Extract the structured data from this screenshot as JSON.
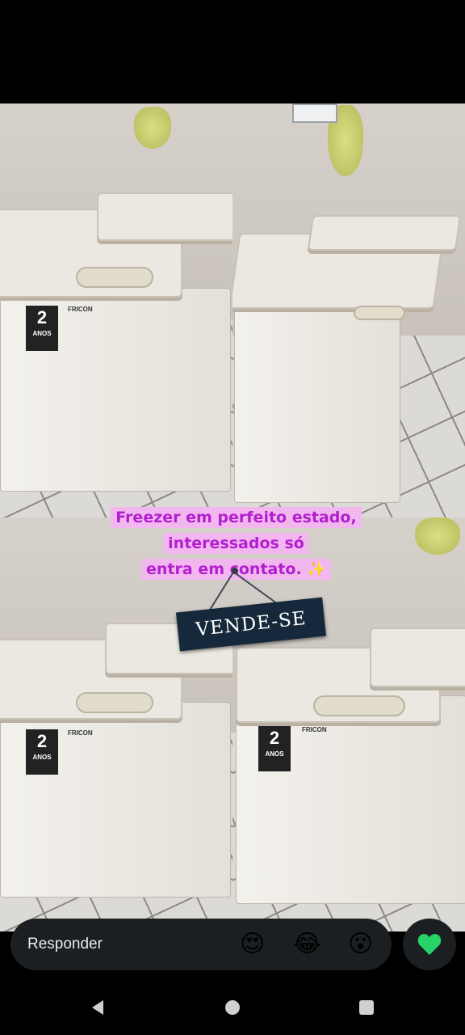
{
  "story": {
    "caption_line1": "Freezer em perfeito estado, interessados só",
    "caption_line2": "entra em contato. ✨",
    "sign_text": "VENDE-SE",
    "photos": [
      {
        "freezer_brand": "FRICON",
        "warranty_number": "2",
        "warranty_label": "ANOS"
      },
      {
        "freezer_brand": "",
        "warranty_number": "",
        "warranty_label": ""
      },
      {
        "freezer_brand": "FRICON",
        "warranty_number": "2",
        "warranty_label": "ANOS"
      },
      {
        "freezer_brand": "FRICON",
        "warranty_number": "2",
        "warranty_label": "ANOS"
      }
    ]
  },
  "reply_bar": {
    "placeholder": "Responder",
    "reactions": [
      "😍",
      "😂",
      "😮"
    ],
    "like_icon": "heart-icon",
    "accent_color": "#25d366"
  },
  "nav": {
    "back_icon": "back-triangle-icon",
    "home_icon": "home-circle-icon",
    "recents_icon": "recents-square-icon"
  }
}
